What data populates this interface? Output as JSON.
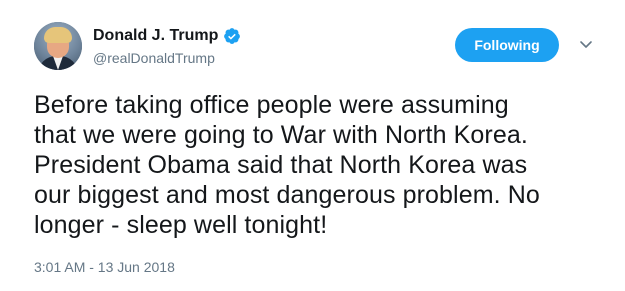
{
  "author": {
    "display_name": "Donald J. Trump",
    "handle": "@realDonaldTrump",
    "verified_icon": "verified-badge-icon",
    "avatar_icon": "profile-photo"
  },
  "follow_button": {
    "label": "Following",
    "color": "#1da1f2"
  },
  "menu_icon": "chevron-down-icon",
  "tweet": {
    "lines": [
      "Before taking office people were assuming",
      "that we were going to War with North Korea.",
      "President Obama said that North Korea was",
      "our biggest and most dangerous problem. No",
      "longer - sleep well tonight!"
    ],
    "timestamp": "3:01 AM - 13 Jun 2018"
  },
  "colors": {
    "text": "#14171a",
    "secondary": "#657786",
    "accent": "#1da1f2"
  }
}
